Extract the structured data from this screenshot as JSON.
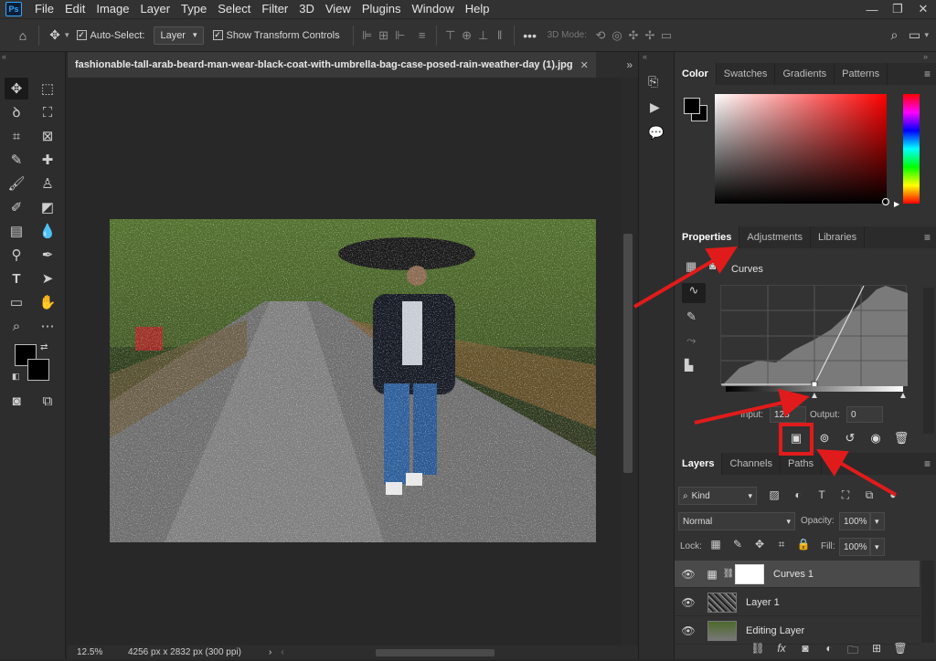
{
  "app": {
    "logo": "Ps"
  },
  "menu": {
    "items": [
      "File",
      "Edit",
      "Image",
      "Layer",
      "Type",
      "Select",
      "Filter",
      "3D",
      "View",
      "Plugins",
      "Window",
      "Help"
    ]
  },
  "window_controls": {
    "minimize": "—",
    "restore": "❐",
    "close": "✕"
  },
  "options_bar": {
    "auto_select_label": "Auto-Select:",
    "auto_select_value": "Layer",
    "show_transform_label": "Show Transform Controls",
    "mode_3d_label": "3D Mode:",
    "more": "•••"
  },
  "document": {
    "tab_title": "fashionable-tall-arab-beard-man-wear-black-coat-with-umbrella-bag-case-posed-rain-weather-day (1).jpg",
    "zoom": "12.5%",
    "doc_info": "4256 px x 2832 px (300 ppi)"
  },
  "color_panel": {
    "tabs": [
      "Color",
      "Swatches",
      "Gradients",
      "Patterns"
    ],
    "active": "Color"
  },
  "properties_panel": {
    "tabs": [
      "Properties",
      "Adjustments",
      "Libraries"
    ],
    "active": "Properties",
    "title": "Curves",
    "input_label": "Input:",
    "input_value": "128",
    "output_label": "Output:",
    "output_value": "0"
  },
  "layers_panel": {
    "tabs": [
      "Layers",
      "Channels",
      "Paths"
    ],
    "active": "Layers",
    "kind_label": "Kind",
    "blend_mode": "Normal",
    "opacity_label": "Opacity:",
    "opacity_value": "100%",
    "lock_label": "Lock:",
    "fill_label": "Fill:",
    "fill_value": "100%",
    "layers": [
      {
        "name": "Curves 1"
      },
      {
        "name": "Layer 1"
      },
      {
        "name": "Editing Layer"
      }
    ]
  },
  "colors": {
    "accent_red": "#e11b1b",
    "ps_blue": "#31a8ff"
  }
}
